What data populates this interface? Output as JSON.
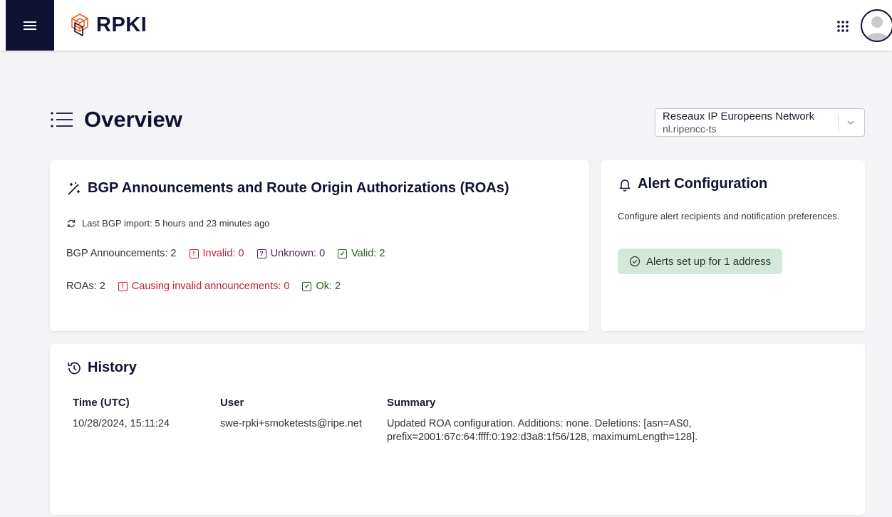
{
  "app": {
    "logo_text": "RPKI"
  },
  "header": {
    "menu_icon": "hamburger-icon",
    "apps_icon": "grid-dots-icon",
    "avatar_icon": "user-avatar-icon"
  },
  "page": {
    "title": "Overview",
    "title_icon": "list-icon"
  },
  "org_selector": {
    "name": "Reseaux IP Europeens Network",
    "id": "nl.ripencc-ts"
  },
  "bgp_card": {
    "title": "BGP Announcements and Route Origin Authorizations (ROAs)",
    "last_import": "Last BGP import: 5 hours and 23 minutes ago",
    "announcements_label": "BGP Announcements: 2",
    "invalid": "Invalid: 0",
    "unknown": "Unknown: 0",
    "valid": "Valid: 2",
    "roas_label": "ROAs: 2",
    "causing_invalid": "Causing invalid announcements: 0",
    "ok": "Ok: 2"
  },
  "alert_card": {
    "title": "Alert Configuration",
    "description": "Configure alert recipients and notification preferences.",
    "status": "Alerts set up for 1 address"
  },
  "history": {
    "title": "History",
    "columns": [
      "Time (UTC)",
      "User",
      "Summary"
    ],
    "rows": [
      {
        "time": "10/28/2024, 15:11:24",
        "user": "swe-rpki+smoketests@ripe.net",
        "summary": "Updated ROA configuration. Additions: none. Deletions: [asn=AS0, prefix=2001:67c:64:ffff:0:192:d3a8:1f56/128, maximumLength=128]."
      }
    ]
  },
  "colors": {
    "navy": "#0f1233",
    "invalid": "#c0202f",
    "unknown": "#4a2a5c",
    "valid": "#2b5a1f",
    "alert_pill": "#d3e8da",
    "logo_accent": "#e8652a"
  }
}
